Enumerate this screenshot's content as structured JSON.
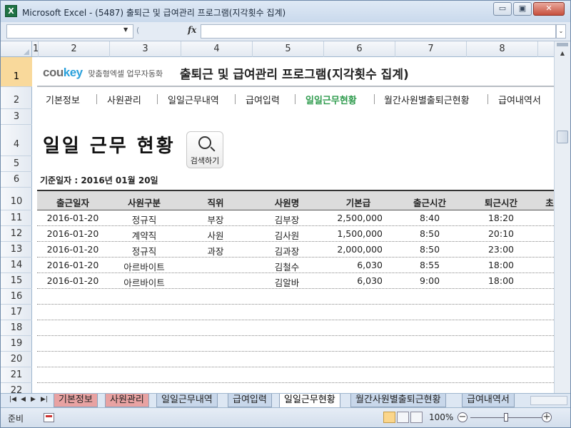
{
  "window": {
    "title": "Microsoft Excel - (5487) 출퇴근 및 급여관리 프로그램(지각횟수 집계)",
    "app_icon": "X",
    "minimize_icon": "minimize-icon",
    "maximize_icon": "restore-icon",
    "close_icon": "close-icon",
    "minimize_glyph": "▭",
    "maximize_glyph": "▣",
    "close_glyph": "✕"
  },
  "formula_bar": {
    "name_box": "",
    "fx_label": "fx",
    "formula": "",
    "dropdown_glyph": "▼",
    "expand_glyph": "⌄"
  },
  "column_headers": [
    "1",
    "2",
    "3",
    "4",
    "5",
    "6",
    "7",
    "8"
  ],
  "row_headers": [
    "1",
    "2",
    "3",
    "4",
    "5",
    "6",
    "10",
    "11",
    "12",
    "13",
    "14",
    "15",
    "16",
    "17",
    "18",
    "19",
    "20",
    "21",
    "22"
  ],
  "selected_row": "1",
  "logo": {
    "main_part1": "cou",
    "main_part2": "key",
    "sub": "맞춤형엑셀 업무자동화",
    "accent_color": "#2aa1dc"
  },
  "main_title": "출퇴근 및 급여관리 프로그램(지각횟수 집계)",
  "nav": {
    "items": [
      "기본정보",
      "사원관리",
      "일일근무내역",
      "급여입력",
      "일일근무현황",
      "월간사원별출퇴근현황",
      "급여내역서"
    ],
    "active": "일일근무현황",
    "active_color": "#2e9b4d"
  },
  "page_heading": "일일 근무 현황",
  "search_button": {
    "label": "검색하기",
    "icon": "search-icon"
  },
  "base_date": "기준일자 : 2016년 01월 20일",
  "table": {
    "headers": [
      "출근일자",
      "사원구분",
      "직위",
      "사원명",
      "기본급",
      "출근시간",
      "퇴근시간",
      "초"
    ],
    "rows": [
      [
        "2016-01-20",
        "정규직",
        "부장",
        "김부장",
        "2,500,000",
        "8:40",
        "18:20"
      ],
      [
        "2016-01-20",
        "계약직",
        "사원",
        "김사원",
        "1,500,000",
        "8:50",
        "20:10"
      ],
      [
        "2016-01-20",
        "정규직",
        "과장",
        "김과장",
        "2,000,000",
        "8:50",
        "23:00"
      ],
      [
        "2016-01-20",
        "아르바이트",
        "",
        "김철수",
        "6,030",
        "8:55",
        "18:00"
      ],
      [
        "2016-01-20",
        "아르바이트",
        "",
        "김알바",
        "6,030",
        "9:00",
        "18:00"
      ]
    ],
    "empty_rows": 7
  },
  "sheet_tabs": {
    "tabs": [
      {
        "label": "기본정보",
        "style": "red"
      },
      {
        "label": "사원관리",
        "style": "red"
      },
      {
        "label": "일일근무내역",
        "style": "blue"
      },
      {
        "label": "급여입력",
        "style": "blue"
      },
      {
        "label": "일일근무현황",
        "style": "active"
      },
      {
        "label": "월간사원별출퇴근현황",
        "style": "blue"
      },
      {
        "label": "급여내역서",
        "style": "blue"
      }
    ],
    "nav_glyphs": [
      "|◀",
      "◀",
      "▶",
      "▶|"
    ]
  },
  "status_bar": {
    "status": "준비",
    "zoom": "100%",
    "zoom_level": 0.5,
    "zoom_minus": "−",
    "zoom_plus": "+"
  }
}
